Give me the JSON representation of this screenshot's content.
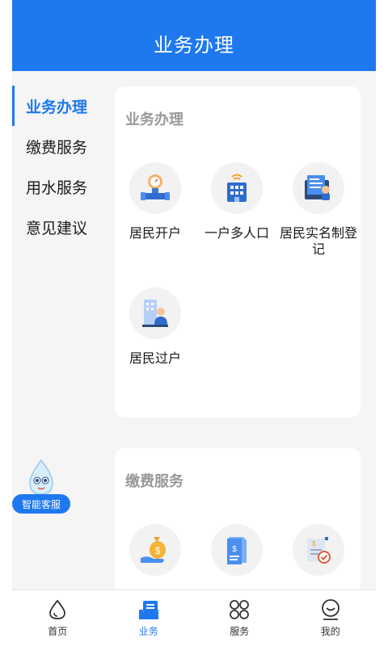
{
  "header": {
    "title": "业务办理"
  },
  "sidebar": {
    "items": [
      {
        "label": "业务办理",
        "active": true
      },
      {
        "label": "缴费服务",
        "active": false
      },
      {
        "label": "用水服务",
        "active": false
      },
      {
        "label": "意见建议",
        "active": false
      }
    ]
  },
  "sections": {
    "business": {
      "title": "业务办理",
      "items": [
        {
          "label": "居民开户",
          "icon": "water-meter-icon"
        },
        {
          "label": "一户多人口",
          "icon": "building-icon"
        },
        {
          "label": "居民实名制登记",
          "icon": "document-register-icon"
        },
        {
          "label": "居民过户",
          "icon": "person-building-icon"
        }
      ]
    },
    "payment": {
      "title": "缴费服务",
      "items": [
        {
          "icon": "money-bag-icon"
        },
        {
          "icon": "bill-document-icon"
        },
        {
          "icon": "invoice-check-icon"
        }
      ]
    }
  },
  "assistant": {
    "label": "智能客服"
  },
  "tabbar": {
    "items": [
      {
        "label": "首页",
        "icon": "water-drop-icon",
        "active": false
      },
      {
        "label": "业务",
        "icon": "business-tray-icon",
        "active": true
      },
      {
        "label": "服务",
        "icon": "grid-petals-icon",
        "active": false
      },
      {
        "label": "我的",
        "icon": "face-smile-icon",
        "active": false
      }
    ]
  },
  "colors": {
    "primary": "#1e78f0",
    "background": "#f5f5f5",
    "card": "#ffffff",
    "muted_title": "#999999"
  }
}
